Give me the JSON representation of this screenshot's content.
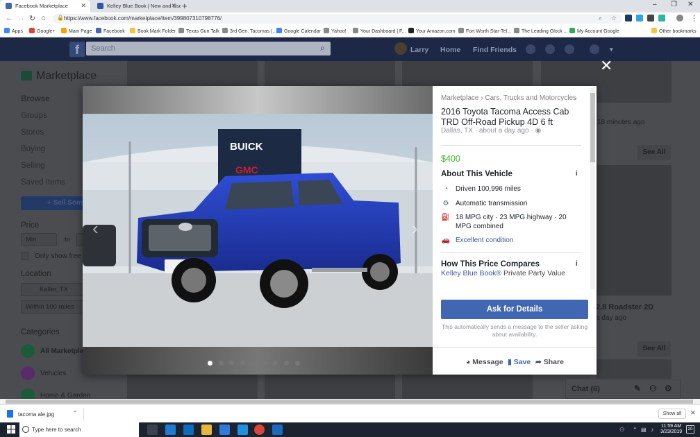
{
  "browser": {
    "tabs": [
      {
        "label": "Facebook Marketplace",
        "active": true,
        "favicon_color": "#4267b2"
      },
      {
        "label": "Kelley Blue Book | New and Used Car...",
        "active": false,
        "favicon_color": "#2c5aa0"
      }
    ],
    "url": "https://www.facebook.com/marketplace/item/399807310798776/",
    "bookmarks": [
      {
        "label": "Apps",
        "color": "#4285f4"
      },
      {
        "label": "Google+",
        "color": "#db4437"
      },
      {
        "label": "Main Page",
        "color": "#f4a300"
      },
      {
        "label": "Facebook",
        "color": "#4267b2"
      },
      {
        "label": "Book Mark Folder",
        "color": "#f5c542"
      },
      {
        "label": "Texas Gun Talk",
        "color": "#888888"
      },
      {
        "label": "3rd Gen. Tacomas (...",
        "color": "#888888"
      },
      {
        "label": "Google Calendar",
        "color": "#4285f4"
      },
      {
        "label": "Yahoo!",
        "color": "#888888"
      },
      {
        "label": "Your Dashboard | F...",
        "color": "#888888"
      },
      {
        "label": "Your Amazon.com",
        "color": "#222222"
      },
      {
        "label": "Fort Worth Star-Tel...",
        "color": "#888888"
      },
      {
        "label": "The Leading Glock ...",
        "color": "#888888"
      },
      {
        "label": "My Account Google",
        "color": "#34a853"
      }
    ],
    "other_bookmarks": "Other bookmarks"
  },
  "facebook": {
    "search_placeholder": "Search",
    "user": "Larry",
    "home": "Home",
    "find_friends": "Find Friends"
  },
  "sidebar": {
    "title": "Marketplace",
    "nav": [
      "Browse",
      "Groups",
      "Stores",
      "Buying",
      "Selling",
      "Saved Items"
    ],
    "sell_button": "+ Sell Something",
    "price_label": "Price",
    "price_min_placeholder": "Min",
    "price_to": "to",
    "free_only": "Only show free",
    "location_label": "Location",
    "location_value": "Keller, TX",
    "radius_value": "Within 100 miles",
    "categories_label": "Categories",
    "categories": [
      {
        "label": "All Marketplace",
        "color": "#1d5a3a"
      },
      {
        "label": "Vehicles",
        "color": "#5a2a6a"
      },
      {
        "label": "Home & Garden",
        "color": "#1d5a3a"
      }
    ]
  },
  "background": {
    "time_ago": "18 minutes ago",
    "see_all_1": "See All",
    "see_all_2": "See All",
    "item_title": "2.8 Roadster 2D",
    "item_time": "a day ago",
    "chat_label": "Chat (6)"
  },
  "listing": {
    "breadcrumb": "Marketplace › Cars, Trucks and Motorcycles",
    "title": "2016 Toyota Tacoma Access Cab TRD Off-Road Pickup 4D 6 ft",
    "location": "Dallas, TX · about a day ago ·",
    "price": "$400",
    "about_heading": "About This Vehicle",
    "features": [
      {
        "icon": "speedometer-icon",
        "glyph": "◔",
        "text": "Driven 100,996 miles",
        "link": false
      },
      {
        "icon": "transmission-icon",
        "glyph": "⚙",
        "text": "Automatic transmission",
        "link": false
      },
      {
        "icon": "gas-pump-icon",
        "glyph": "⛽",
        "text": "18 MPG city · 23 MPG highway · 20 MPG combined",
        "link": false
      },
      {
        "icon": "car-icon",
        "glyph": "🚗",
        "text": "Excellent condition",
        "link": true
      }
    ],
    "price_heading": "How This Price Compares",
    "kbb_link": "Kelley Blue Book®",
    "kbb_suffix": " Private Party Value",
    "ask_button": "Ask for Details",
    "ask_note": "This automatically sends a message to the seller asking about availability.",
    "actions": {
      "message": "Message",
      "save": "Save",
      "share": "Share"
    },
    "photo_count": 9,
    "photo_active": 0,
    "dealer_sign_1": "BUICK",
    "dealer_sign_2": "GMC"
  },
  "downloads": {
    "file": "tacoma ale.jpg",
    "show_all": "Show all"
  },
  "taskbar": {
    "search_placeholder": "Type here to search",
    "time": "11:59 AM",
    "date": "3/23/2019",
    "notifications": "20"
  }
}
